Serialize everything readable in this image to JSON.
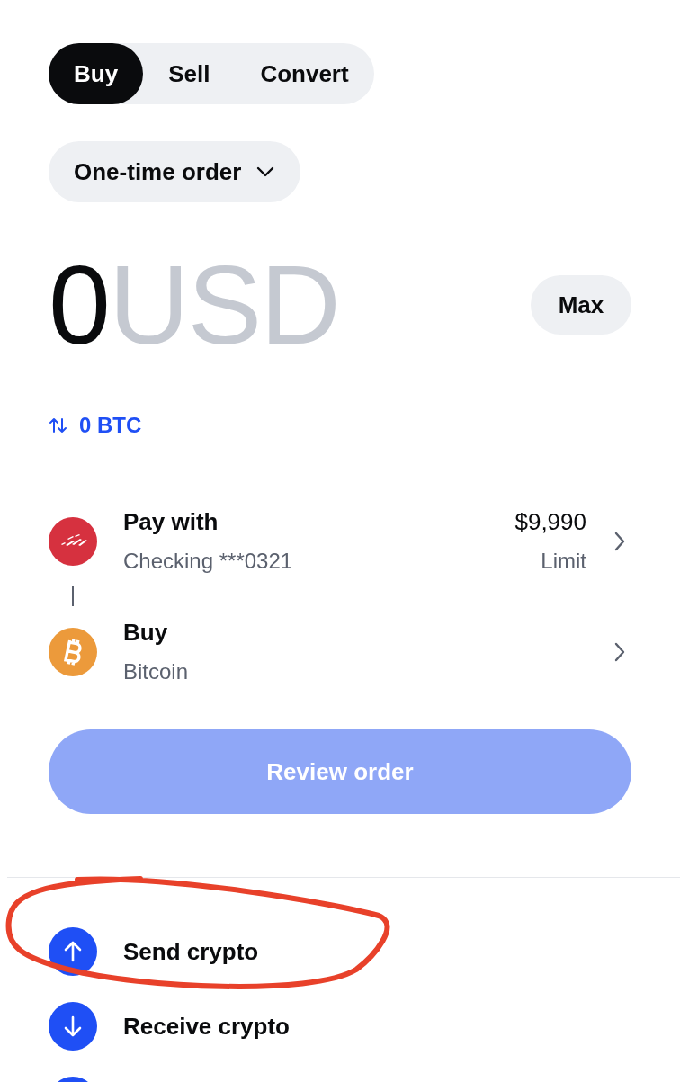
{
  "tabs": [
    {
      "label": "Buy",
      "selected": true
    },
    {
      "label": "Sell",
      "selected": false
    },
    {
      "label": "Convert",
      "selected": false
    }
  ],
  "order_type": {
    "label": "One-time order"
  },
  "amount": {
    "value": "0",
    "currency": "USD"
  },
  "max_button": "Max",
  "conversion": {
    "label": "0 BTC"
  },
  "payment_rows": [
    {
      "kind": "bank",
      "title": "Pay with",
      "subtitle": "Checking ***0321",
      "value": "$9,990",
      "value_caption": "Limit"
    },
    {
      "kind": "bitcoin",
      "title": "Buy",
      "subtitle": "Bitcoin"
    }
  ],
  "review_button": {
    "label": "Review order",
    "disabled": true
  },
  "actions": [
    {
      "kind": "send",
      "label": "Send crypto",
      "circled": true
    },
    {
      "kind": "receive",
      "label": "Receive crypto",
      "circled": false
    },
    {
      "kind": "other"
    }
  ]
}
